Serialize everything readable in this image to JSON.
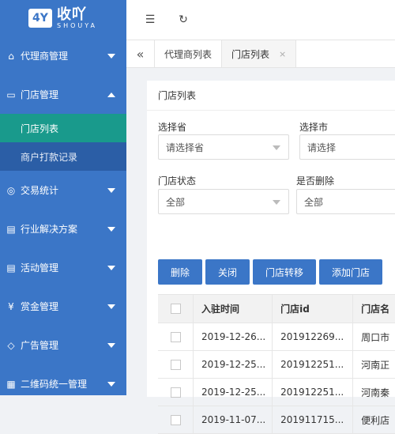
{
  "logo": {
    "mark": "4Y",
    "main": "收吖",
    "sub": "SHOUYA"
  },
  "sidebar": {
    "items": [
      {
        "icon": "⌂",
        "label": "代理商管理"
      },
      {
        "icon": "▭",
        "label": "门店管理"
      },
      {
        "icon": "◎",
        "label": "交易统计"
      },
      {
        "icon": "▤",
        "label": "行业解决方案"
      },
      {
        "icon": "▤",
        "label": "活动管理"
      },
      {
        "icon": "¥",
        "label": "赏金管理"
      },
      {
        "icon": "◇",
        "label": "广告管理"
      },
      {
        "icon": "▦",
        "label": "二维码统一管理"
      }
    ],
    "submenu": [
      {
        "label": "门店列表"
      },
      {
        "label": "商户打款记录"
      }
    ]
  },
  "topbar": {
    "menu_icon": "☰",
    "refresh_icon": "↻"
  },
  "tabs": {
    "collapse": "«",
    "items": [
      {
        "label": "代理商列表"
      },
      {
        "label": "门店列表",
        "close": "×"
      }
    ]
  },
  "card": {
    "title": "门店列表",
    "filters": {
      "province_label": "选择省",
      "province_value": "请选择省",
      "city_label": "选择市",
      "city_value": "请选择",
      "status_label": "门店状态",
      "status_value": "全部",
      "deleted_label": "是否删除",
      "deleted_value": "全部"
    },
    "buttons": {
      "delete": "删除",
      "close": "关闭",
      "transfer": "门店转移",
      "add": "添加门店"
    },
    "table": {
      "headers": [
        "入驻时间",
        "门店id",
        "门店名"
      ],
      "rows": [
        [
          "2019-12-26...",
          "201912269...",
          "周口市"
        ],
        [
          "2019-12-25...",
          "201912251...",
          "河南正"
        ],
        [
          "2019-12-25...",
          "201912251...",
          "河南秦"
        ],
        [
          "2019-11-07...",
          "201911715...",
          "便利店"
        ]
      ]
    }
  },
  "colors": {
    "sidebar": "#3b76c7",
    "submenu": "#2b5ea6",
    "active": "#199a8c",
    "primary": "#3b76c7"
  }
}
